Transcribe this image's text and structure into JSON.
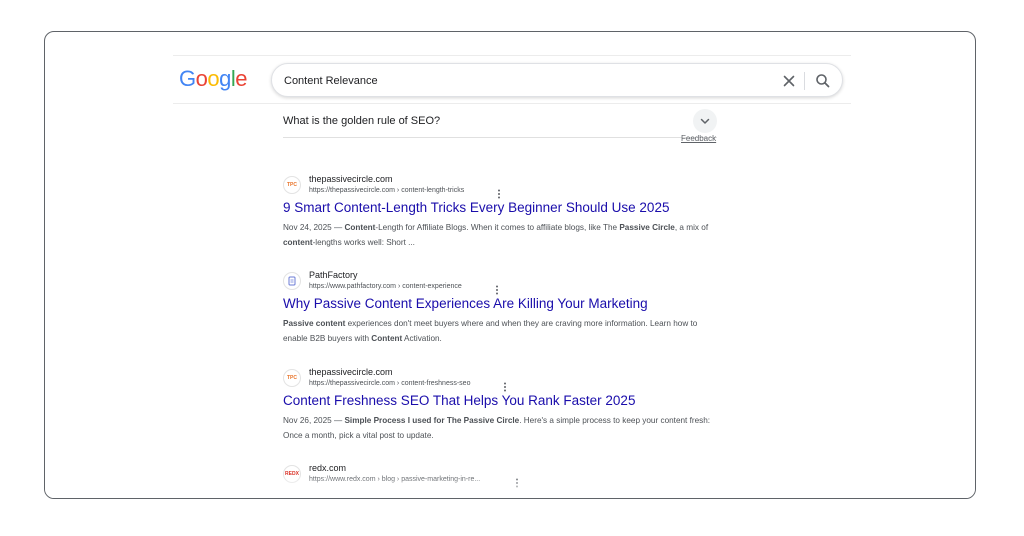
{
  "logo": {
    "text": "Google",
    "letters": [
      {
        "ch": "G",
        "color": "#4285F4"
      },
      {
        "ch": "o",
        "color": "#EA4335"
      },
      {
        "ch": "o",
        "color": "#FBBC05"
      },
      {
        "ch": "g",
        "color": "#4285F4"
      },
      {
        "ch": "l",
        "color": "#34A853"
      },
      {
        "ch": "e",
        "color": "#EA4335"
      }
    ]
  },
  "search": {
    "query": "Content Relevance",
    "clear_icon": "close-icon",
    "search_icon": "search-icon"
  },
  "people_also_ask": {
    "question": "What is the golden rule of SEO?",
    "feedback_label": "Feedback"
  },
  "results": [
    {
      "favicon_text": "TPC",
      "favicon_color": "#e8742a",
      "site": "thepassivecircle.com",
      "url": "https://thepassivecircle.com › content-length-tricks",
      "title": "9 Smart Content-Length Tricks Every Beginner Should Use 2025",
      "snippet_html": "Nov 24, 2025 — <b>Content</b>-Length for Affiliate Blogs. When it comes to affiliate blogs, like The <b>Passive Circle</b>, a mix of <b>content</b>-lengths works well: Short ..."
    },
    {
      "favicon_text": "",
      "favicon_color": "#6b7bd6",
      "site": "PathFactory",
      "url": "https://www.pathfactory.com › content-experience",
      "title": "Why Passive Content Experiences Are Killing Your Marketing",
      "snippet_html": "<b>Passive content</b> experiences don't meet buyers where and when they are craving more information. Learn how to enable B2B buyers with <b>Content</b> Activation."
    },
    {
      "favicon_text": "TPC",
      "favicon_color": "#e8742a",
      "site": "thepassivecircle.com",
      "url": "https://thepassivecircle.com › content-freshness-seo",
      "title": "Content Freshness SEO That Helps You Rank Faster 2025",
      "snippet_html": "Nov 26, 2025 — <b>Simple Process I used for The Passive Circle</b>. Here's a simple process to keep your content fresh: Once a month, pick a vital post to update."
    },
    {
      "favicon_text": "REDX",
      "favicon_color": "#d93025",
      "site": "redx.com",
      "url": "https://www.redx.com › blog › passive-marketing-in-re...",
      "title": "",
      "snippet_html": ""
    }
  ]
}
